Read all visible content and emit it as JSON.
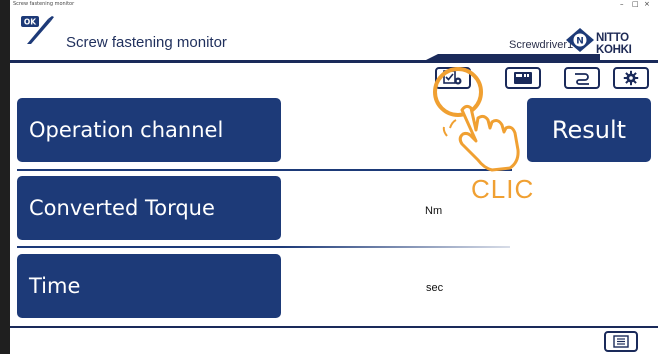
{
  "window": {
    "title": "Screw fastening monitor",
    "controls": [
      "–",
      "□",
      "×"
    ]
  },
  "header": {
    "app_icon_label": "OK",
    "app_title": "Screw fastening monitor",
    "device_name": "Screwdriver1",
    "brand": "NITTO KOHKI"
  },
  "toolbar": {
    "buttons": [
      {
        "name": "monitor-settings",
        "icon": "checklist-gear-icon"
      },
      {
        "name": "display",
        "icon": "display-icon"
      },
      {
        "name": "connection",
        "icon": "cable-icon"
      },
      {
        "name": "settings",
        "icon": "gear-icon"
      }
    ]
  },
  "rows": {
    "operation_channel": {
      "label": "Operation channel"
    },
    "result": {
      "label": "Result"
    },
    "converted_torque": {
      "label": "Converted Torque",
      "unit": "Nm"
    },
    "time": {
      "label": "Time",
      "unit": "sec"
    }
  },
  "overlay": {
    "callout_text": "CLIC"
  },
  "colors": {
    "accent": "#1d3a78",
    "highlight": "#f0a032",
    "frame": "#1f1f1f"
  }
}
